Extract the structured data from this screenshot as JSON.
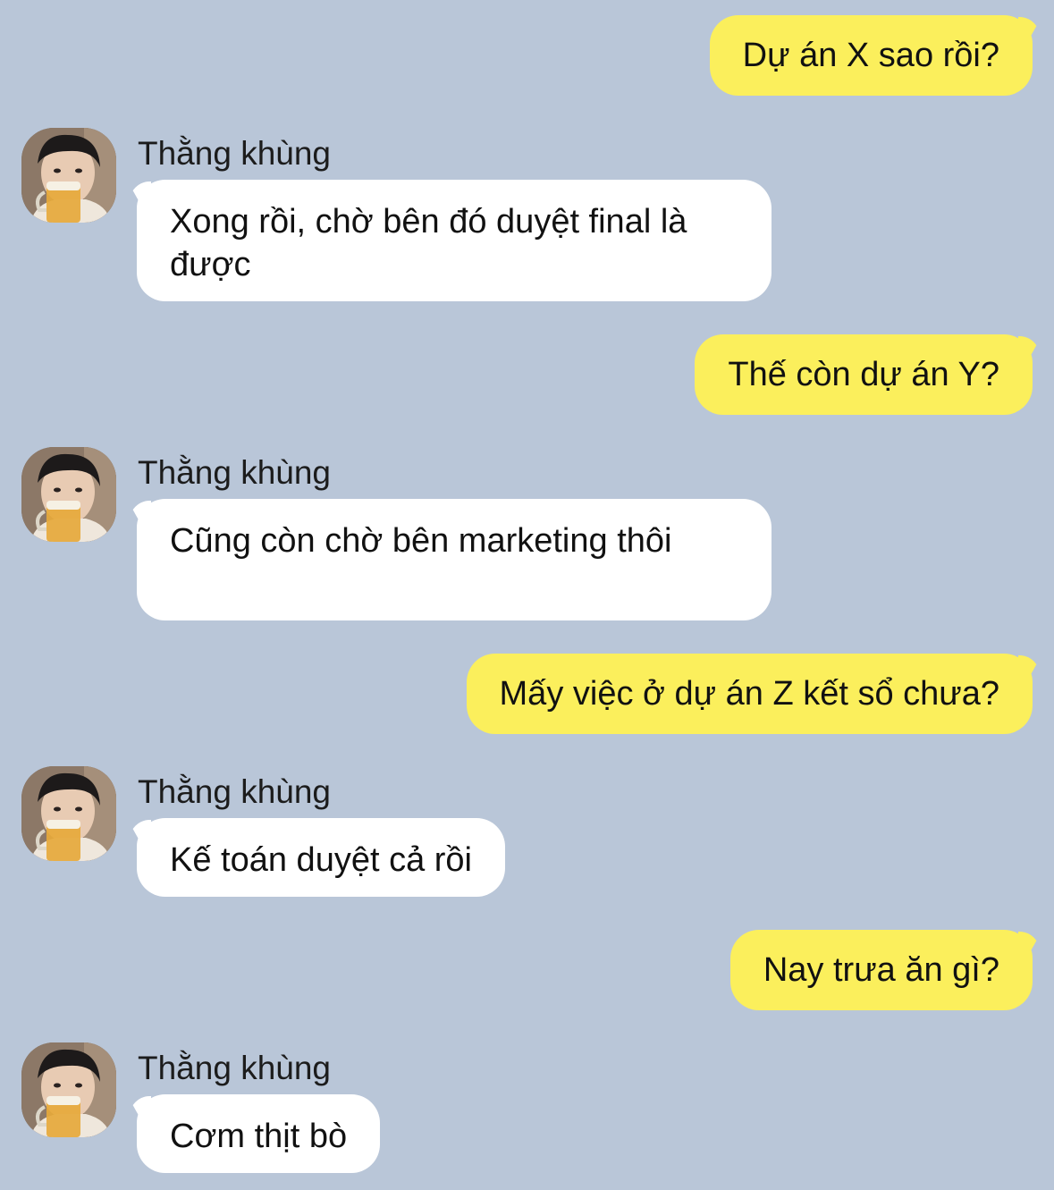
{
  "messages": [
    {
      "direction": "out",
      "text": "Dự án X sao rồi?"
    },
    {
      "direction": "in",
      "sender": "Thằng khùng",
      "text": "Xong rồi, chờ bên đó duyệt final là được"
    },
    {
      "direction": "out",
      "text": "Thế còn dự án Y?"
    },
    {
      "direction": "in",
      "sender": "Thằng khùng",
      "text": "Cũng còn chờ bên marketing thôi"
    },
    {
      "direction": "out",
      "text": "Mấy việc ở dự án Z kết sổ chưa?"
    },
    {
      "direction": "in",
      "sender": "Thằng khùng",
      "text": "Kế toán duyệt cả rồi"
    },
    {
      "direction": "out",
      "text": "Nay trưa ăn gì?"
    },
    {
      "direction": "in",
      "sender": "Thằng khùng",
      "text": "Cơm thịt bò"
    }
  ],
  "colors": {
    "background": "#b9c6d8",
    "outgoing_bubble": "#fbef5c",
    "incoming_bubble": "#ffffff"
  },
  "icons": {
    "avatar": "contact-avatar-photo"
  }
}
